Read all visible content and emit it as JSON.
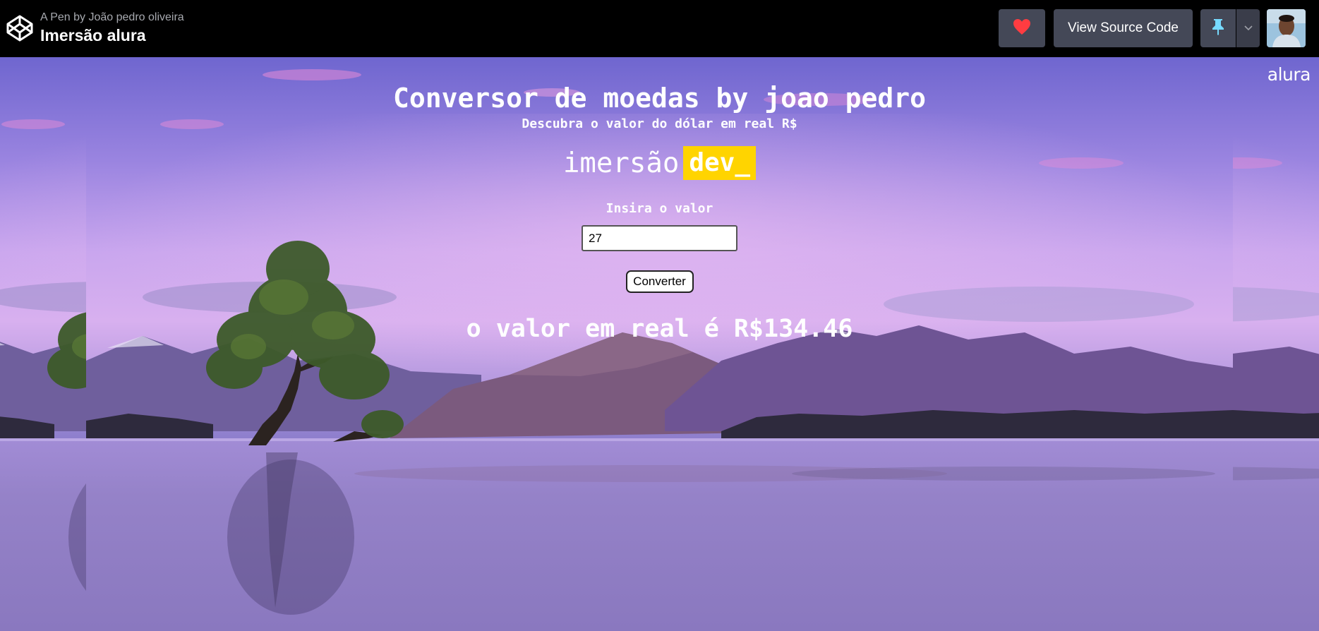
{
  "header": {
    "pen_by": "A Pen by João pedro oliveira",
    "pen_title": "Imersão alura",
    "view_source_label": "View Source Code",
    "like_icon": "heart-icon",
    "pin_icon": "pin-icon",
    "menu_icon": "chevron-down-icon"
  },
  "preview": {
    "brand_logo": "alura",
    "title": "Conversor de moedas by joao pedro",
    "subtitle": "Descubra o valor do dólar em real R$",
    "imersao_word": "imersão",
    "dev_badge": "dev_",
    "input_label": "Insira o valor",
    "input_value": "27",
    "convert_label": "Converter",
    "result_text": "o valor em real é R$134.46"
  },
  "colors": {
    "header_bg": "#000000",
    "button_bg": "#444857",
    "heart": "#ff3c41",
    "pin": "#47cf73",
    "dev_badge_bg": "#ffd400"
  }
}
